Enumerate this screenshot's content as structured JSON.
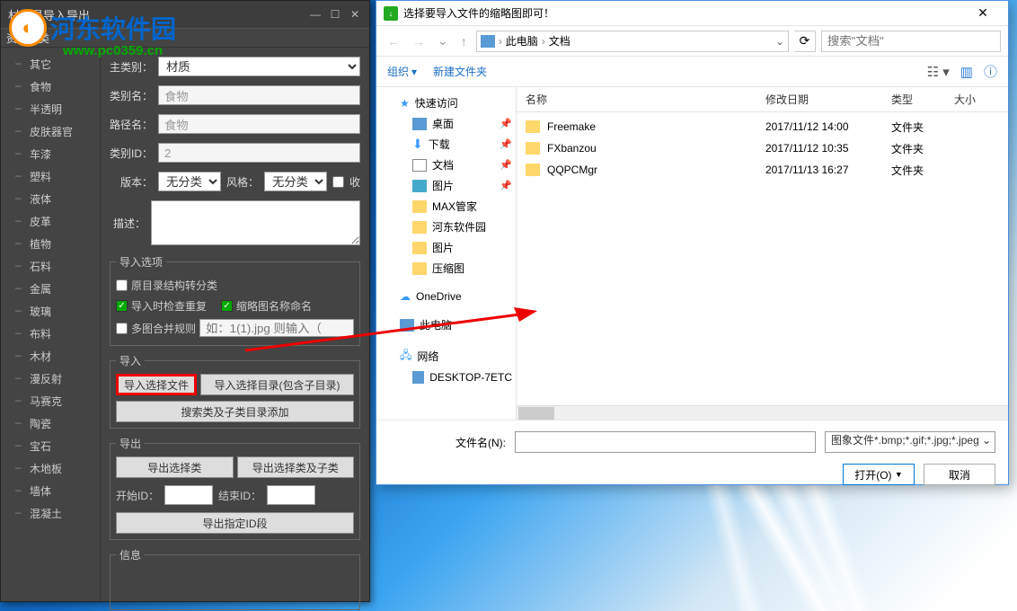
{
  "watermark": {
    "text": "河东软件园",
    "url": "www.pc0359.cn"
  },
  "app": {
    "title": "材批是导入导出",
    "category_header": "资源分类",
    "categories": [
      "其它",
      "食物",
      "半透明",
      "皮肤器官",
      "车漆",
      "塑料",
      "液体",
      "皮革",
      "植物",
      "石料",
      "金属",
      "玻璃",
      "布料",
      "木材",
      "漫反射",
      "马赛克",
      "陶瓷",
      "宝石",
      "木地板",
      "墙体",
      "混凝土"
    ],
    "form": {
      "main_cat_label": "主类别：",
      "main_cat_value": "材质",
      "cat_name_label": "类别名：",
      "cat_name_value": "食物",
      "path_name_label": "路径名：",
      "path_name_value": "食物",
      "cat_id_label": "类别ID：",
      "cat_id_value": "2",
      "version_label": "版本：",
      "version_value": "无分类",
      "style_label": "风格：",
      "style_value": "无分类",
      "collect_label": "收",
      "desc_label": "描述：",
      "import_opts_legend": "导入选项",
      "chk_struct": "原目录结构转分类",
      "chk_dup": "导入时检查重复",
      "chk_thumb": "缩略图名称命名",
      "chk_merge": "多图合并规则",
      "merge_hint": "如：1(1).jpg 则输入（",
      "import_legend": "导入",
      "btn_import_file": "导入选择文件",
      "btn_import_dir": "导入选择目录(包含子目录)",
      "btn_search_add": "搜索类及子类目录添加",
      "export_legend": "导出",
      "btn_export_cat": "导出选择类",
      "btn_export_sub": "导出选择类及子类",
      "start_id_label": "开始ID：",
      "end_id_label": "结束ID：",
      "btn_export_id": "导出指定ID段",
      "info_legend": "信息"
    }
  },
  "dialog": {
    "title": "选择要导入文件的缩略图即可！",
    "breadcrumb": {
      "pc": "此电脑",
      "docs": "文档"
    },
    "search_placeholder": "搜索\"文档\"",
    "toolbar": {
      "org": "组织",
      "new_folder": "新建文件夹"
    },
    "sidebar": [
      {
        "type": "header",
        "label": "快速访问",
        "icon": "star"
      },
      {
        "label": "桌面",
        "icon": "pc",
        "pin": true,
        "lvl": 2
      },
      {
        "label": "下载",
        "icon": "dl",
        "pin": true,
        "lvl": 2
      },
      {
        "label": "文档",
        "icon": "doc",
        "pin": true,
        "lvl": 2
      },
      {
        "label": "图片",
        "icon": "img",
        "pin": true,
        "lvl": 2
      },
      {
        "label": "MAX管家",
        "icon": "fold",
        "lvl": 2
      },
      {
        "label": "河东软件园",
        "icon": "fold",
        "lvl": 2
      },
      {
        "label": "图片",
        "icon": "fold",
        "lvl": 2
      },
      {
        "label": "压缩图",
        "icon": "fold",
        "lvl": 2
      },
      {
        "type": "spacer"
      },
      {
        "label": "OneDrive",
        "icon": "cloud"
      },
      {
        "type": "spacer"
      },
      {
        "label": "此电脑",
        "icon": "pc"
      },
      {
        "type": "spacer"
      },
      {
        "label": "网络",
        "icon": "net"
      },
      {
        "label": "DESKTOP-7ETC",
        "icon": "pc",
        "lvl": 2
      }
    ],
    "columns": {
      "name": "名称",
      "date": "修改日期",
      "type": "类型",
      "size": "大小"
    },
    "files": [
      {
        "name": "Freemake",
        "date": "2017/11/12 14:00",
        "type": "文件夹",
        "size": ""
      },
      {
        "name": "FXbanzou",
        "date": "2017/11/12 10:35",
        "type": "文件夹",
        "size": ""
      },
      {
        "name": "QQPCMgr",
        "date": "2017/11/13 16:27",
        "type": "文件夹",
        "size": ""
      }
    ],
    "footer": {
      "filename_label": "文件名(N):",
      "filter": "图象文件*.bmp;*.gif;*.jpg;*.jpeg",
      "open": "打开(O)",
      "cancel": "取消"
    }
  }
}
